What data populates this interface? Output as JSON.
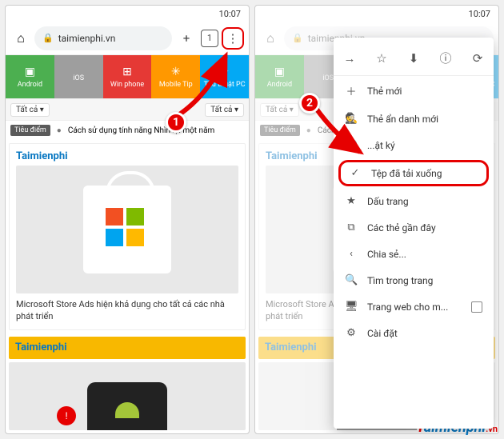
{
  "status": {
    "time": "10:07"
  },
  "browser": {
    "url_text": "taimienphi.vn",
    "plus_icon": "+",
    "tabs_icon": "1"
  },
  "categories": [
    {
      "label": "Android",
      "color": "#4caf50",
      "icon": "▣"
    },
    {
      "label": "iOS",
      "color": "#9e9e9e",
      "icon": ""
    },
    {
      "label": "Win phone",
      "color": "#e53935",
      "icon": "⊞"
    },
    {
      "label": "Mobile Tip",
      "color": "#ff9800",
      "icon": "✳"
    },
    {
      "label": "Thủ thuật PC",
      "color": "#03a9f4",
      "icon": "✦"
    }
  ],
  "filter": {
    "left": "Tất cả ▾",
    "right": "Tất cả ▾"
  },
  "news": {
    "tag": "Tiêu điểm",
    "text": "Cách sử dụng tính năng Nhìn lại một năm"
  },
  "article": {
    "brand": "Taimienphi",
    "title": "Microsoft Store Ads hiện khả dụng cho tất cả các nhà phát triển"
  },
  "yellow_brand": "Taimienphi",
  "menu_top": {
    "back": "→",
    "star": "☆",
    "download": "⬇",
    "info": "ⓘ",
    "reload": "⟳"
  },
  "menu_items": [
    {
      "icon": "＋",
      "label": "Thẻ mới"
    },
    {
      "icon": "🕵",
      "label": "Thẻ ẩn danh mới"
    },
    {
      "icon": "🕘",
      "label": "...ật ký"
    },
    {
      "icon": "✓",
      "label": "Tệp đã tải xuống",
      "highlight": true
    },
    {
      "icon": "★",
      "label": "Dấu trang"
    },
    {
      "icon": "⧉",
      "label": "Các thẻ gần đây"
    },
    {
      "icon": "‹",
      "label": "Chia sẻ..."
    },
    {
      "icon": "🔍",
      "label": "Tìm trong trang"
    },
    {
      "icon": "🖥",
      "label": "Trang web cho m...",
      "checkbox": true
    },
    {
      "icon": "⚙",
      "label": "Cài đặt"
    }
  ],
  "badges": {
    "one": "1",
    "two": "2"
  },
  "watermark": {
    "t": "T",
    "rest": "aimienphi",
    "suffix": ".vn"
  }
}
